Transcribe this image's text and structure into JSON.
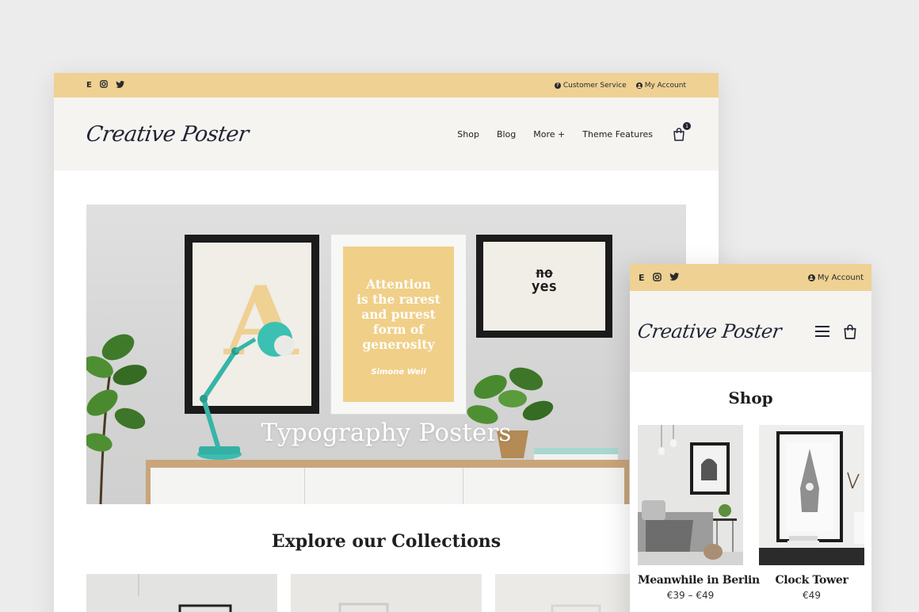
{
  "desktop": {
    "topbar": {
      "social": [
        "E",
        "◎",
        "🐦"
      ],
      "customer_service": "Customer Service",
      "my_account": "My Account"
    },
    "header": {
      "logo": "Creative Poster",
      "nav": [
        "Shop",
        "Blog",
        "More +",
        "Theme Features"
      ],
      "cart_count": "1"
    },
    "hero": {
      "title": "Typography Posters",
      "poster_letter": "A",
      "quote_lines": [
        "Attention",
        "is the rarest",
        "and purest",
        "form of",
        "generosity"
      ],
      "quote_author": "Simone Weil",
      "noyes_struck": "no",
      "noyes_word": "yes"
    },
    "collections_title": "Explore our Collections"
  },
  "mobile": {
    "topbar": {
      "my_account": "My Account"
    },
    "header": {
      "logo": "Creative Poster"
    },
    "shop_title": "Shop",
    "products": [
      {
        "name": "Meanwhile in Berlin",
        "price": "€39 – €49"
      },
      {
        "name": "Clock Tower",
        "price": "€49"
      }
    ]
  },
  "colors": {
    "accent": "#eed193",
    "header_bg": "#f6f4f1",
    "ink": "#1f2433"
  }
}
